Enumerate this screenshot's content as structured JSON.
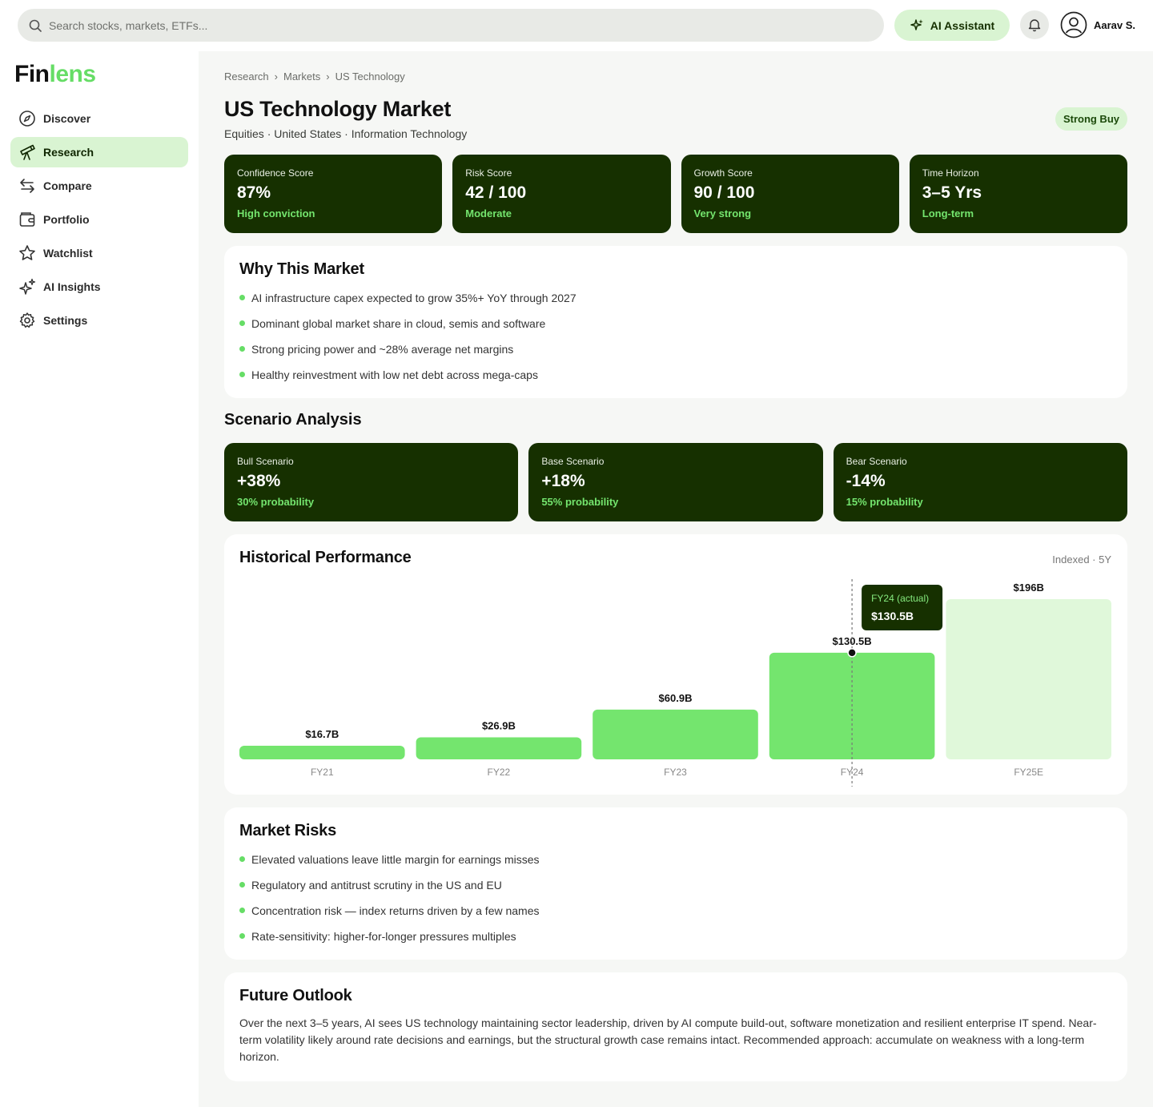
{
  "topbar": {
    "search_placeholder": "Search stocks, markets, ETFs...",
    "ai_label": "AI Assistant",
    "user_name": "Aarav S."
  },
  "brand": {
    "part1": "Fin",
    "part2": "lens"
  },
  "sidebar": {
    "items": [
      {
        "label": "Discover",
        "icon": "compass-icon"
      },
      {
        "label": "Research",
        "icon": "telescope-icon",
        "active": true
      },
      {
        "label": "Compare",
        "icon": "arrows-icon"
      },
      {
        "label": "Portfolio",
        "icon": "wallet-icon"
      },
      {
        "label": "Watchlist",
        "icon": "star-icon"
      },
      {
        "label": "AI Insights",
        "icon": "sparkle-icon"
      },
      {
        "label": "Settings",
        "icon": "gear-icon"
      }
    ]
  },
  "breadcrumb": [
    "Research",
    "Markets",
    "US Technology"
  ],
  "breadcrumb_sep": "›",
  "page": {
    "title": "US Technology Market",
    "subtitle": "Equities · United States · Information Technology",
    "badge": "Strong Buy"
  },
  "kpis": [
    {
      "label": "Confidence Score",
      "value": "87%",
      "note": "High conviction"
    },
    {
      "label": "Risk Score",
      "value": "42 / 100",
      "note": "Moderate"
    },
    {
      "label": "Growth Score",
      "value": "90 / 100",
      "note": "Very strong"
    },
    {
      "label": "Time Horizon",
      "value": "3–5 Yrs",
      "note": "Long-term"
    }
  ],
  "why": {
    "title": "Why This Market",
    "items": [
      "AI infrastructure capex expected to grow 35%+ YoY through 2027",
      "Dominant global market share in cloud, semis and software",
      "Strong pricing power and ~28% average net margins",
      "Healthy reinvestment with low net debt across mega-caps"
    ]
  },
  "scenario": {
    "title": "Scenario Analysis",
    "items": [
      {
        "label": "Bull Scenario",
        "value": "+38%",
        "note": "30% probability"
      },
      {
        "label": "Base Scenario",
        "value": "+18%",
        "note": "55% probability"
      },
      {
        "label": "Bear Scenario",
        "value": "-14%",
        "note": "15% probability"
      }
    ]
  },
  "history": {
    "title": "Historical Performance",
    "meta": "Indexed · 5Y"
  },
  "chart_data": {
    "type": "bar",
    "categories": [
      "FY21",
      "FY22",
      "FY23",
      "FY24",
      "FY25E"
    ],
    "values": [
      16.7,
      26.9,
      60.9,
      130.5,
      196
    ],
    "labels": [
      "$16.7B",
      "$26.9B",
      "$60.9B",
      "$130.5B",
      "$196B"
    ],
    "estimated": [
      false,
      false,
      false,
      false,
      true
    ],
    "tooltip": {
      "category": "FY24",
      "title": "FY24 (actual)",
      "value": "$130.5B"
    },
    "colors": {
      "actual": "#74e56e",
      "estimate": "#e0f8da",
      "tooltip": "#163000"
    }
  },
  "risks": {
    "title": "Market Risks",
    "items": [
      "Elevated valuations leave little margin for earnings misses",
      "Regulatory and antitrust scrutiny in the US and EU",
      "Concentration risk — index returns driven by a few names",
      "Rate-sensitivity: higher-for-longer pressures multiples"
    ]
  },
  "outlook": {
    "title": "Future Outlook",
    "text": "Over the next 3–5 years, AI sees US technology maintaining sector leadership, driven by AI compute build-out, software monetization and resilient enterprise IT spend. Near-term volatility likely around rate decisions and earnings, but the structural growth case remains intact. Recommended approach: accumulate on weakness with a long-term horizon."
  }
}
